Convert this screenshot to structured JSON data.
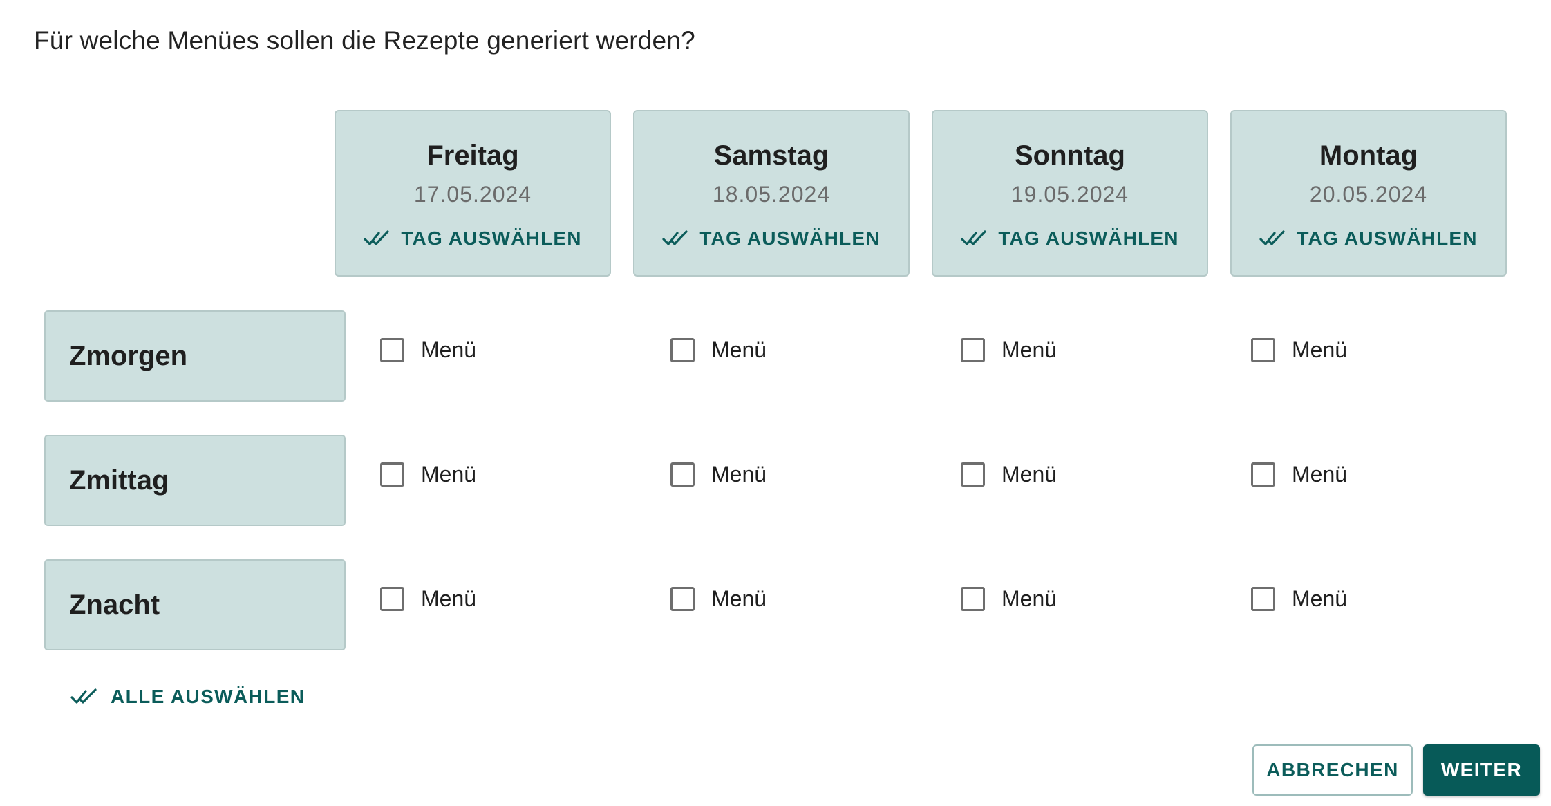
{
  "dialog": {
    "title": "Für welche Menües sollen die Rezepte generiert werden?"
  },
  "days": [
    {
      "name": "Freitag",
      "date": "17.05.2024",
      "select_label": "TAG AUSWÄHLEN"
    },
    {
      "name": "Samstag",
      "date": "18.05.2024",
      "select_label": "TAG AUSWÄHLEN"
    },
    {
      "name": "Sonntag",
      "date": "19.05.2024",
      "select_label": "TAG AUSWÄHLEN"
    },
    {
      "name": "Montag",
      "date": "20.05.2024",
      "select_label": "TAG AUSWÄHLEN"
    }
  ],
  "meals": [
    {
      "label": "Zmorgen"
    },
    {
      "label": "Zmittag"
    },
    {
      "label": "Znacht"
    }
  ],
  "checkbox_label": "Menü",
  "checked": [
    [
      false,
      false,
      false,
      false
    ],
    [
      false,
      false,
      false,
      false
    ],
    [
      false,
      false,
      false,
      false
    ]
  ],
  "select_all_label": "ALLE AUSWÄHLEN",
  "actions": {
    "cancel_label": "ABBRECHEN",
    "next_label": "WEITER"
  },
  "colors": {
    "accent": "#0b5c5a",
    "card_bg": "#cde0df",
    "primary_button": "#075a58"
  },
  "icons": {
    "select": "double-check-icon"
  }
}
